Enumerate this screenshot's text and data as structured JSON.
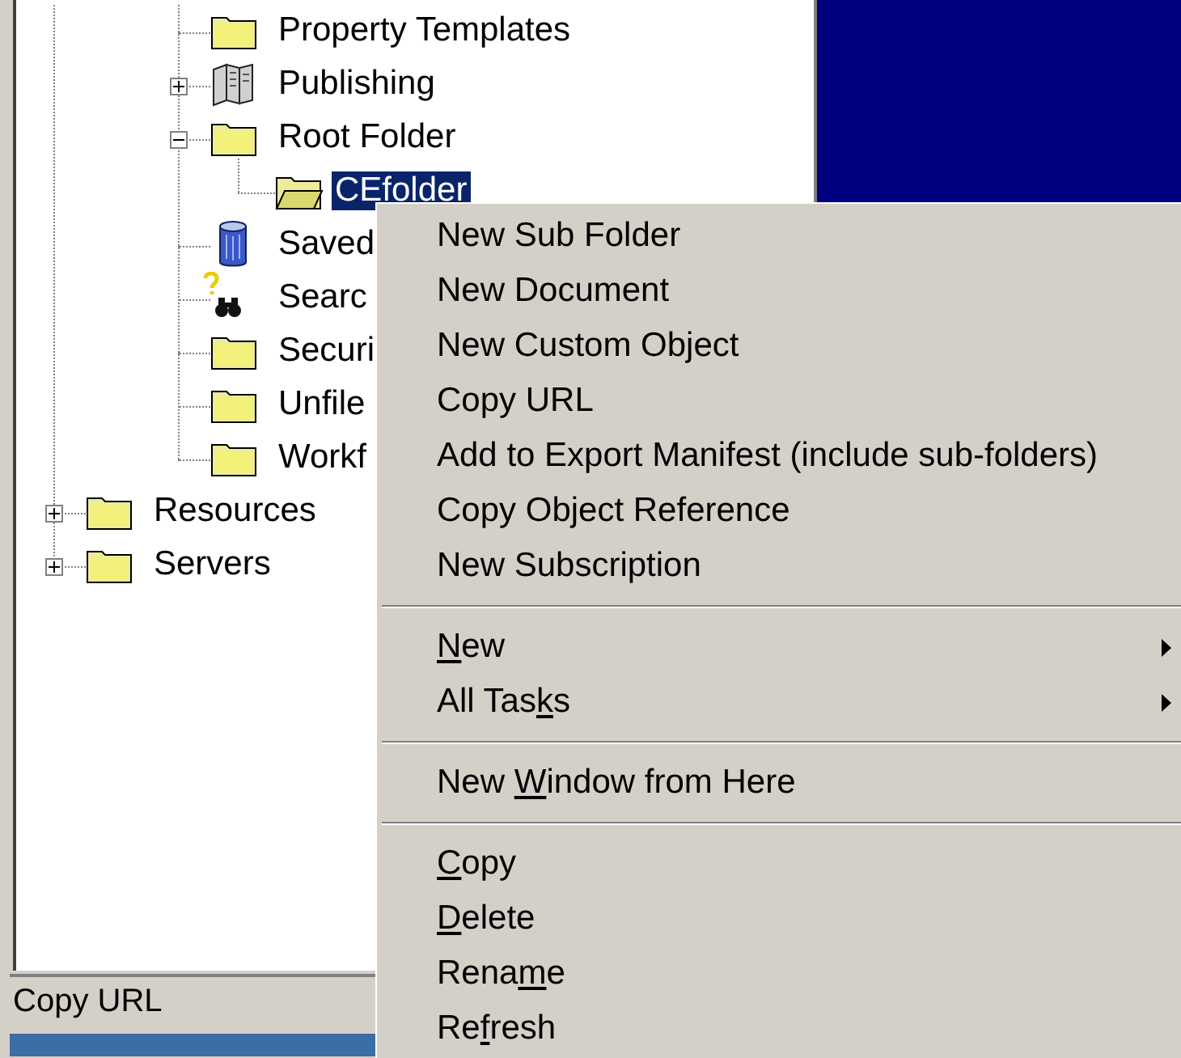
{
  "tree": {
    "items": [
      {
        "children": [
          {
            "label": "Property Templates",
            "kind": "folder",
            "selected": false
          },
          {
            "label": "Publishing",
            "kind": "book",
            "expanded": false,
            "selected": false
          },
          {
            "label": "Root Folder",
            "kind": "folder",
            "expanded": true,
            "selected": false,
            "children": [
              {
                "label": "CEfolder",
                "kind": "open-folder",
                "selected": true
              }
            ]
          },
          {
            "label": "Saved",
            "kind": "database",
            "selected": false
          },
          {
            "label": "Searc",
            "kind": "search",
            "selected": false
          },
          {
            "label": "Securi",
            "kind": "folder",
            "selected": false
          },
          {
            "label": "Unfile",
            "kind": "folder",
            "selected": false
          },
          {
            "label": "Workf",
            "kind": "folder",
            "selected": false
          }
        ]
      },
      {
        "label": "Resources",
        "kind": "folder",
        "expanded": false,
        "selected": false
      },
      {
        "label": "Servers",
        "kind": "folder",
        "expanded": false,
        "selected": false
      }
    ]
  },
  "context_menu": [
    {
      "kind": "item",
      "label": "New Sub Folder"
    },
    {
      "kind": "item",
      "label": "New Document"
    },
    {
      "kind": "item",
      "label": "New Custom Object"
    },
    {
      "kind": "item",
      "label": "Copy URL"
    },
    {
      "kind": "item",
      "label": "Add to Export Manifest (include sub-folders)"
    },
    {
      "kind": "item",
      "label": "Copy Object Reference"
    },
    {
      "kind": "item",
      "label": "New Subscription"
    },
    {
      "kind": "separator"
    },
    {
      "kind": "submenu",
      "label_parts": [
        {
          "text": "N",
          "underlined": true
        },
        {
          "text": "ew",
          "underlined": false
        }
      ]
    },
    {
      "kind": "submenu",
      "label_parts": [
        {
          "text": "All Tas",
          "underlined": false
        },
        {
          "text": "k",
          "underlined": true
        },
        {
          "text": "s",
          "underlined": false
        }
      ]
    },
    {
      "kind": "separator"
    },
    {
      "kind": "item",
      "label_parts": [
        {
          "text": "New ",
          "underlined": false
        },
        {
          "text": "W",
          "underlined": true
        },
        {
          "text": "indow from Here",
          "underlined": false
        }
      ]
    },
    {
      "kind": "separator"
    },
    {
      "kind": "item",
      "label_parts": [
        {
          "text": "C",
          "underlined": true
        },
        {
          "text": "opy",
          "underlined": false
        }
      ]
    },
    {
      "kind": "item",
      "label_parts": [
        {
          "text": "D",
          "underlined": true
        },
        {
          "text": "elete",
          "underlined": false
        }
      ]
    },
    {
      "kind": "item",
      "label_parts": [
        {
          "text": "Rena",
          "underlined": false
        },
        {
          "text": "m",
          "underlined": true
        },
        {
          "text": "e",
          "underlined": false
        }
      ]
    },
    {
      "kind": "item",
      "label_parts": [
        {
          "text": "Re",
          "underlined": false
        },
        {
          "text": "f",
          "underlined": true
        },
        {
          "text": "resh",
          "underlined": false
        }
      ]
    }
  ],
  "status_bar": {
    "text": "Copy URL"
  }
}
